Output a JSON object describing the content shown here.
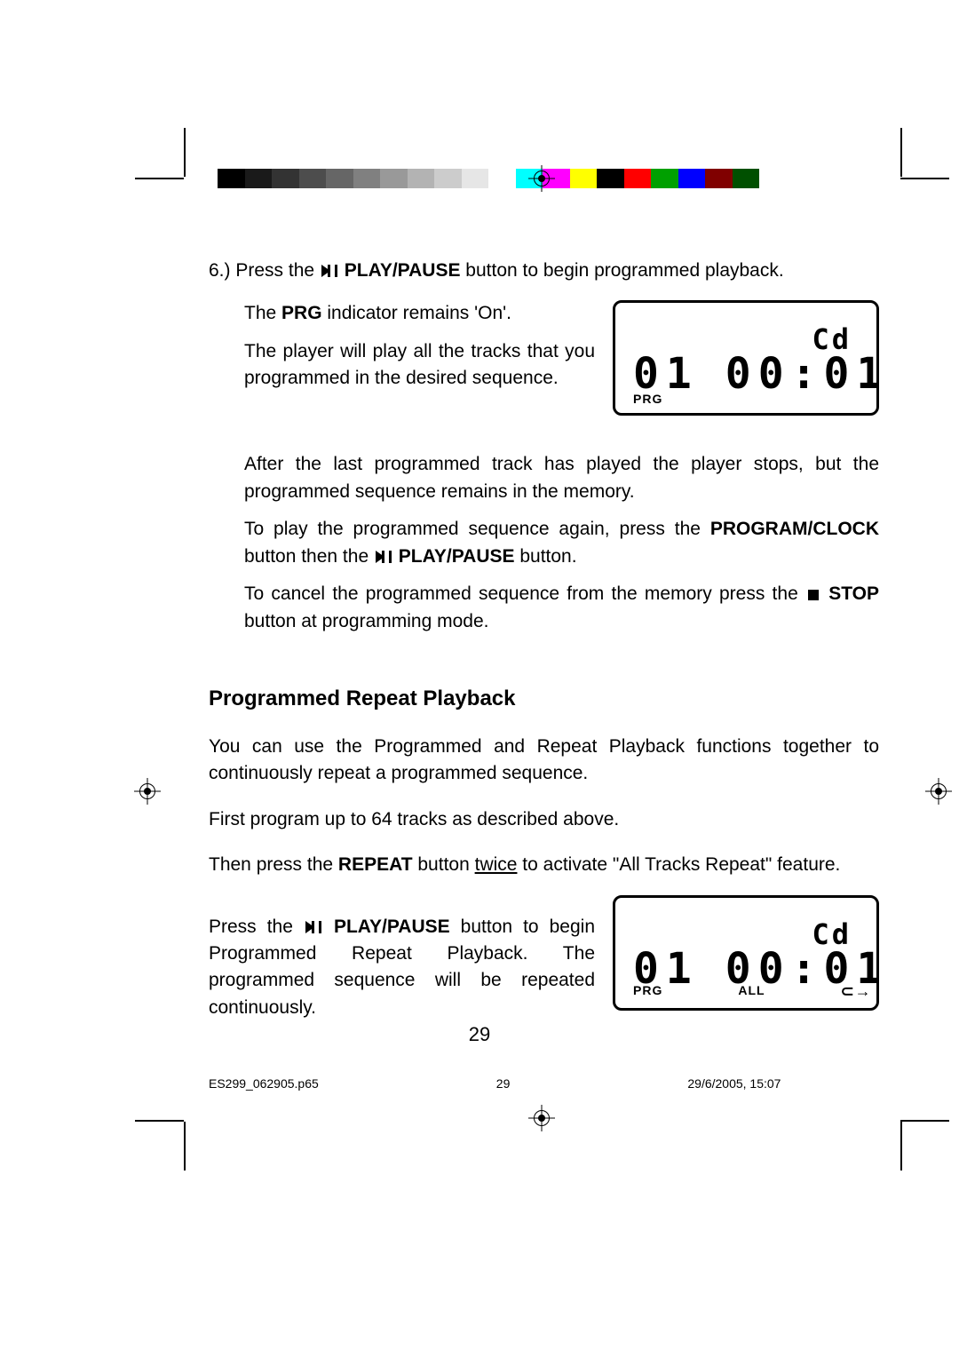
{
  "step6": {
    "number": "6.)",
    "line1_a": "Press the",
    "line1_button": " PLAY/PAUSE",
    "line1_b": " button to begin programmed playback.",
    "para_a_1": "The ",
    "para_a_bold": "PRG",
    "para_a_2": " indicator remains 'On'.",
    "para_b": "The player will play all the tracks that you programmed in the desired sequence.",
    "para_c": "After the last programmed track has played the player stops, but the programmed sequence remains in the memory.",
    "para_d_1": "To play the programmed sequence again, press the ",
    "para_d_bold1": "PROGRAM/CLOCK",
    "para_d_2": " button then the ",
    "para_d_bold2": " PLAY/PAUSE",
    "para_d_3": " button.",
    "para_e_1": "To cancel the programmed sequence from the memory press the ",
    "para_e_bold": " STOP",
    "para_e_2": " button at programming mode."
  },
  "section_title": "Programmed Repeat Playback",
  "sec_p1": "You can use the Programmed and Repeat Playback functions together to continuously repeat a programmed sequence.",
  "sec_p2": "First program up to 64 tracks as described above.",
  "sec_p3_a": "Then press the ",
  "sec_p3_bold": "REPEAT",
  "sec_p3_b": " button ",
  "sec_p3_u": "twice",
  "sec_p3_c": " to activate \"All Tracks Repeat\" feature.",
  "sec_p4_a": "Press the ",
  "sec_p4_bold": " PLAY/PAUSE",
  "sec_p4_b": " button to begin Programmed Repeat Playback. The programmed sequence will be repeated continuously.",
  "lcd1": {
    "mode": "Cd",
    "track": "01",
    "time": "00:01",
    "tag_prg": "PRG"
  },
  "lcd2": {
    "mode": "Cd",
    "track": "01",
    "time": "00:01",
    "tag_prg": "PRG",
    "tag_all": "ALL",
    "repeat_glyph": "⊂→"
  },
  "page_number": "29",
  "footer": {
    "file": "ES299_062905.p65",
    "sheet": "29",
    "timestamp": "29/6/2005, 15:07"
  }
}
